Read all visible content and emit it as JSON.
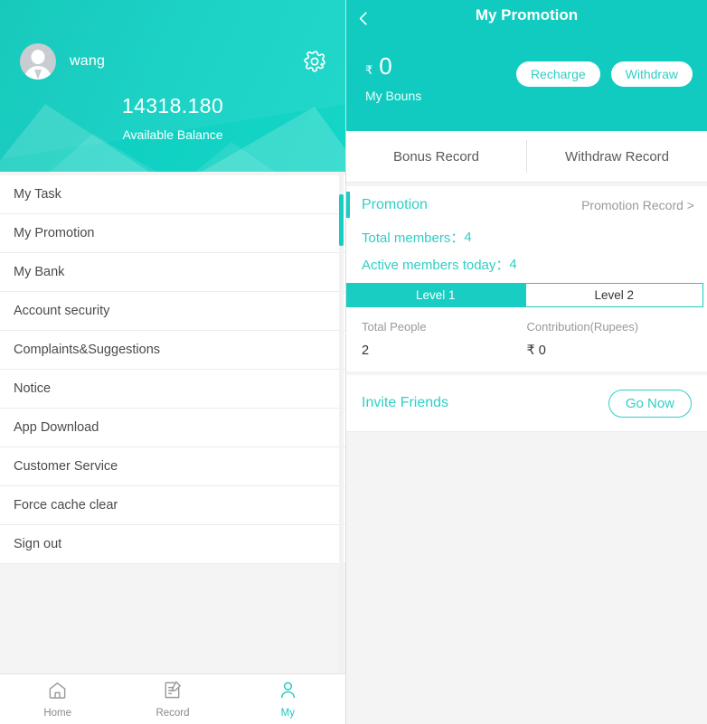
{
  "left": {
    "profile": {
      "avatar_icon": "user-avatar-icon",
      "username": "wang",
      "settings_icon": "gear-icon",
      "balance_amount": "14318.180",
      "balance_label": "Available Balance"
    },
    "menu": {
      "items": [
        {
          "label": "My Task"
        },
        {
          "label": "My Promotion"
        },
        {
          "label": "My Bank"
        },
        {
          "label": "Account security"
        },
        {
          "label": "Complaints&Suggestions"
        },
        {
          "label": "Notice"
        },
        {
          "label": "App Download"
        },
        {
          "label": "Customer Service"
        },
        {
          "label": "Force cache clear"
        },
        {
          "label": "Sign out"
        }
      ]
    },
    "bottom_nav": {
      "items": [
        {
          "label": "Home",
          "icon": "home-icon",
          "active": false
        },
        {
          "label": "Record",
          "icon": "record-icon",
          "active": false
        },
        {
          "label": "My",
          "icon": "person-icon",
          "active": true
        }
      ]
    }
  },
  "right": {
    "header": {
      "back_icon": "chevron-left-icon",
      "title": "My Promotion",
      "bonus_currency": "₹",
      "bonus_amount": "0",
      "bonus_label": "My Bouns",
      "recharge_label": "Recharge",
      "withdraw_label": "Withdraw"
    },
    "record_tabs": [
      {
        "label": "Bonus Record"
      },
      {
        "label": "Withdraw Record"
      }
    ],
    "promotion": {
      "heading": "Promotion",
      "record_link": "Promotion Record >",
      "total_members_label": "Total members：",
      "total_members_value": "4",
      "active_members_label": "Active members today：",
      "active_members_value": "4",
      "level_tabs": [
        {
          "label": "Level 1",
          "active": true
        },
        {
          "label": "Level 2",
          "active": false
        }
      ],
      "stats": {
        "headers": [
          "Total People",
          "Contribution(Rupees)"
        ],
        "values": [
          "2",
          "₹ 0"
        ]
      }
    },
    "invite": {
      "label": "Invite Friends",
      "button_label": "Go Now"
    }
  },
  "colors": {
    "teal": "#12cbc0",
    "teal_dark": "#0ac6b8",
    "teal_text": "#2ecfc6",
    "page_bg": "#f4f4f4"
  }
}
